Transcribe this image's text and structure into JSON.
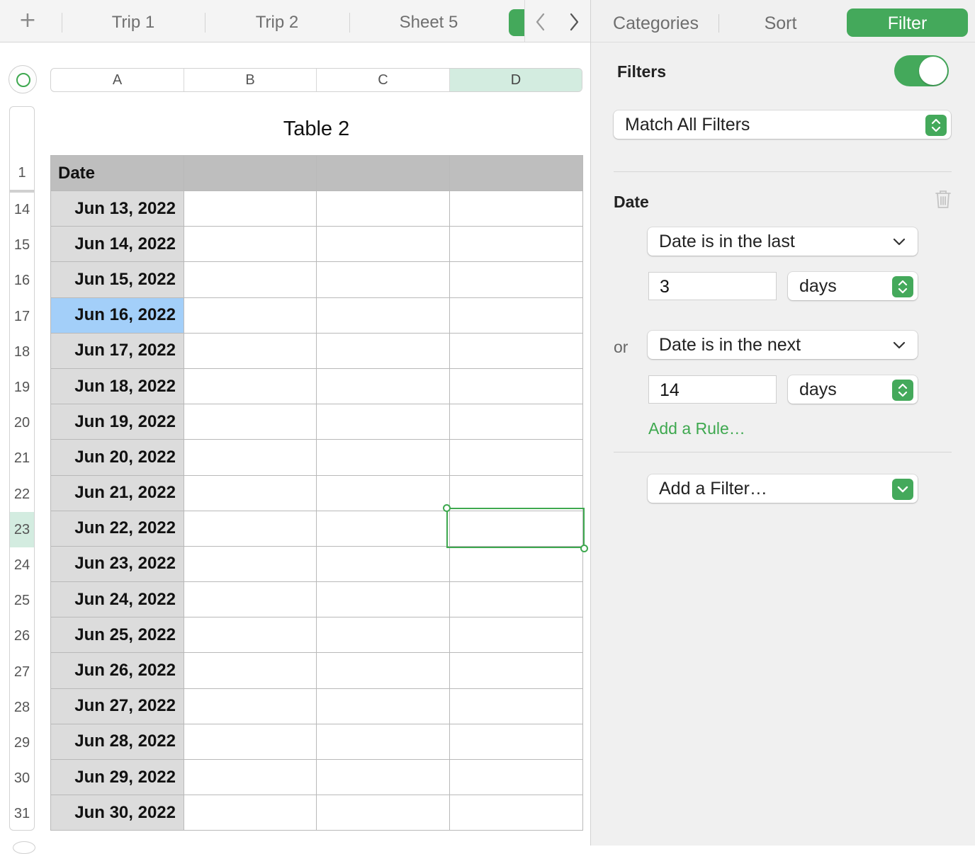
{
  "tabs": {
    "add_label": "+",
    "sheets": [
      "Trip 1",
      "Trip 2",
      "Sheet 5"
    ]
  },
  "sidebar_tabs": [
    "Categories",
    "Sort",
    "Filter"
  ],
  "sheet": {
    "columns": [
      "A",
      "B",
      "C",
      "D"
    ],
    "selected_column": "D",
    "table_title": "Table 2",
    "header_row_number": "1",
    "header": "Date",
    "rows": [
      {
        "n": "14",
        "date": "Jun 13, 2022"
      },
      {
        "n": "15",
        "date": "Jun 14, 2022"
      },
      {
        "n": "16",
        "date": "Jun 15, 2022"
      },
      {
        "n": "17",
        "date": "Jun 16, 2022"
      },
      {
        "n": "18",
        "date": "Jun 17, 2022"
      },
      {
        "n": "19",
        "date": "Jun 18, 2022"
      },
      {
        "n": "20",
        "date": "Jun 19, 2022"
      },
      {
        "n": "21",
        "date": "Jun 20, 2022"
      },
      {
        "n": "22",
        "date": "Jun 21, 2022"
      },
      {
        "n": "23",
        "date": "Jun 22, 2022"
      },
      {
        "n": "24",
        "date": "Jun 23, 2022"
      },
      {
        "n": "25",
        "date": "Jun 24, 2022"
      },
      {
        "n": "26",
        "date": "Jun 25, 2022"
      },
      {
        "n": "27",
        "date": "Jun 26, 2022"
      },
      {
        "n": "28",
        "date": "Jun 27, 2022"
      },
      {
        "n": "29",
        "date": "Jun 28, 2022"
      },
      {
        "n": "30",
        "date": "Jun 29, 2022"
      },
      {
        "n": "31",
        "date": "Jun 30, 2022"
      }
    ],
    "highlighted_date_row": "17",
    "selected_row": "23"
  },
  "filter": {
    "title": "Filters",
    "enabled": true,
    "match_mode": "Match All Filters",
    "column_label": "Date",
    "rule1": {
      "condition": "Date is in the last",
      "value": "3",
      "unit": "days"
    },
    "connector": "or",
    "rule2": {
      "condition": "Date is in the next",
      "value": "14",
      "unit": "days"
    },
    "add_rule": "Add a Rule…",
    "add_filter": "Add a Filter…"
  },
  "colors": {
    "accent": "#44a95b",
    "selected_header": "#d3ece0",
    "selected_cell": "#a3cff9"
  }
}
